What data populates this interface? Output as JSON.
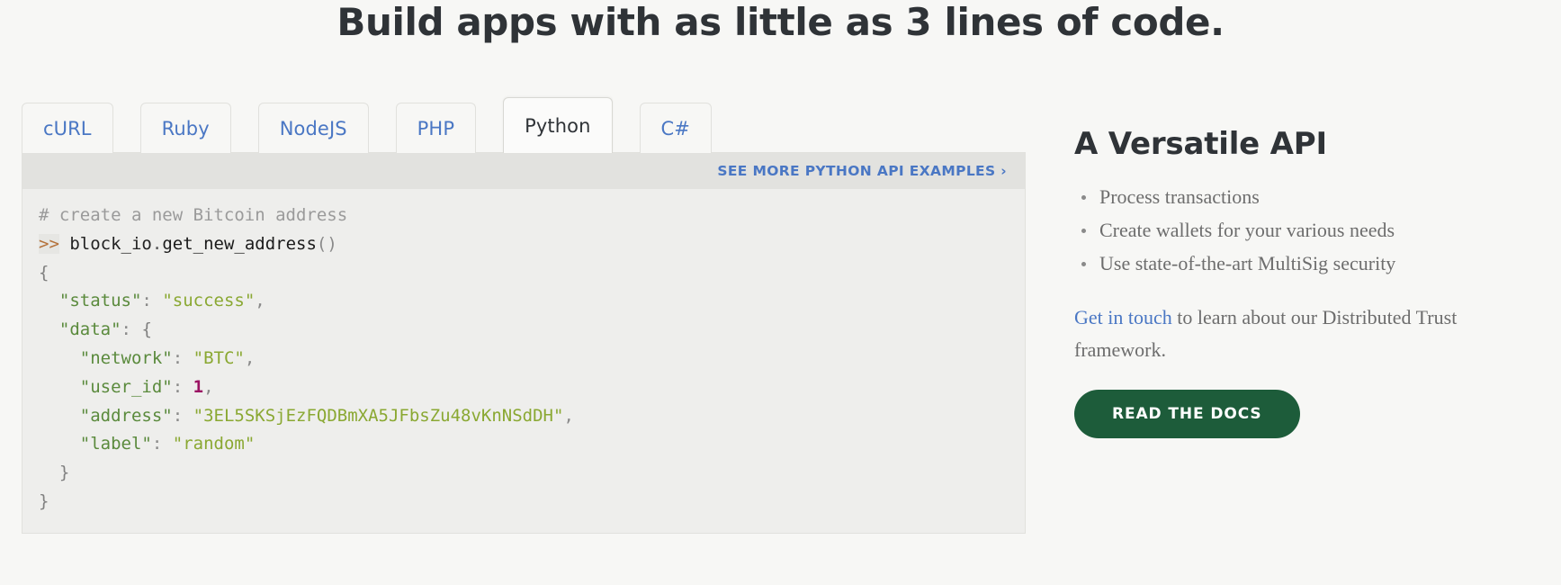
{
  "headline": "Build apps with as little as 3 lines of code.",
  "tabs": [
    {
      "label": "cURL",
      "active": false
    },
    {
      "label": "Ruby",
      "active": false
    },
    {
      "label": "NodeJS",
      "active": false
    },
    {
      "label": "PHP",
      "active": false
    },
    {
      "label": "Python",
      "active": true
    },
    {
      "label": "C#",
      "active": false
    }
  ],
  "examples_link": "SEE MORE PYTHON API EXAMPLES ›",
  "code": {
    "comment": "# create a new Bitcoin address",
    "prompt": ">>",
    "call_object": "block_io",
    "call_method": "get_new_address",
    "call_parens": "()",
    "open_brace": "{",
    "close_brace": "}",
    "inner_close_brace": "}",
    "keys": {
      "status": "\"status\"",
      "data": "\"data\"",
      "network": "\"network\"",
      "user_id": "\"user_id\"",
      "address": "\"address\"",
      "label": "\"label\""
    },
    "values": {
      "status": "\"success\"",
      "network": "\"BTC\"",
      "user_id": "1",
      "address": "\"3EL5SKSjEzFQDBmXA5JFbsZu48vKnNSdDH\"",
      "label": "\"random\""
    },
    "colon": ":",
    "comma": ",",
    "data_open_brace": "{"
  },
  "sidebar": {
    "title": "A Versatile API",
    "features": [
      "Process transactions",
      "Create wallets for your various needs",
      "Use state-of-the-art MultiSig security"
    ],
    "blurb_link": "Get in touch",
    "blurb_rest": " to learn about our Distributed Trust framework.",
    "docs_button": "READ THE DOCS"
  },
  "colors": {
    "page_bg": "#f7f7f5",
    "tab_link": "#4a77c4",
    "code_bg": "#eeeeec",
    "examples_bar_bg": "#e2e2df",
    "button_green": "#1d5c3a",
    "json_key_green": "#5a8a3c",
    "json_string_green": "#8aa832",
    "json_number_magenta": "#9b1363",
    "prompt_orange": "#b4713a"
  }
}
